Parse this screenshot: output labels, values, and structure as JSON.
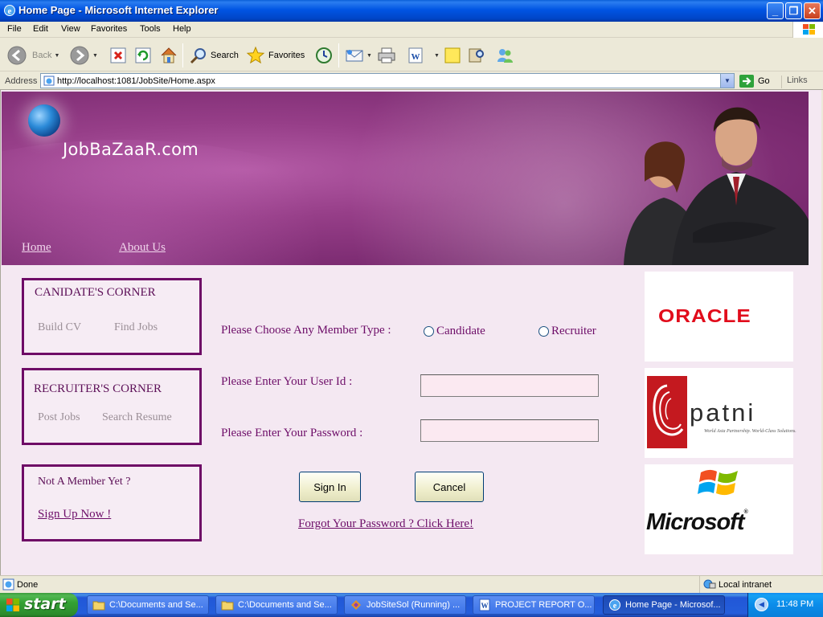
{
  "window": {
    "title": "Home Page - Microsoft Internet Explorer",
    "minimize": "_",
    "maximize": "❐",
    "close": "✕"
  },
  "menu": [
    "File",
    "Edit",
    "View",
    "Favorites",
    "Tools",
    "Help"
  ],
  "toolbar": {
    "back": "Back",
    "search": "Search",
    "favorites": "Favorites"
  },
  "address": {
    "label": "Address",
    "url": "http://localhost:1081/JobSite/Home.aspx",
    "go": "Go",
    "links": "Links"
  },
  "page": {
    "brand": "JobBaZaaR.com",
    "nav": {
      "home": "Home",
      "about": "About Us"
    },
    "candidate_corner": {
      "title": "CANIDATE'S CORNER",
      "links": [
        "Build CV",
        "Find Jobs"
      ]
    },
    "recruiter_corner": {
      "title": "RECRUITER'S CORNER",
      "links": [
        "Post Jobs",
        "Search Resume"
      ]
    },
    "member_box": {
      "title": "Not A Member Yet ?",
      "signup": "Sign Up Now !"
    },
    "form": {
      "member_type_label": "Please Choose Any Member Type :",
      "options": [
        "Candidate",
        "Recruiter"
      ],
      "userid_label": "Please Enter Your User Id :",
      "password_label": "Please Enter Your Password :",
      "signin": "Sign In",
      "cancel": "Cancel",
      "forgot": "Forgot Your Password ? Click Here!"
    },
    "logos": {
      "oracle": "ORACLE",
      "patni": "patni",
      "patni_tagline": "World Asia Partnership. World-Class Solutions.",
      "microsoft": "Microsoft",
      "microsoft_mark": "®"
    }
  },
  "status": {
    "text": "Done",
    "zone": "Local intranet"
  },
  "taskbar": {
    "start": "start",
    "tasks": [
      "C:\\Documents and Se...",
      "C:\\Documents and Se...",
      "JobSiteSol (Running) ...",
      "PROJECT REPORT O...",
      "Home Page - Microsof..."
    ],
    "clock": "11:48 PM"
  }
}
